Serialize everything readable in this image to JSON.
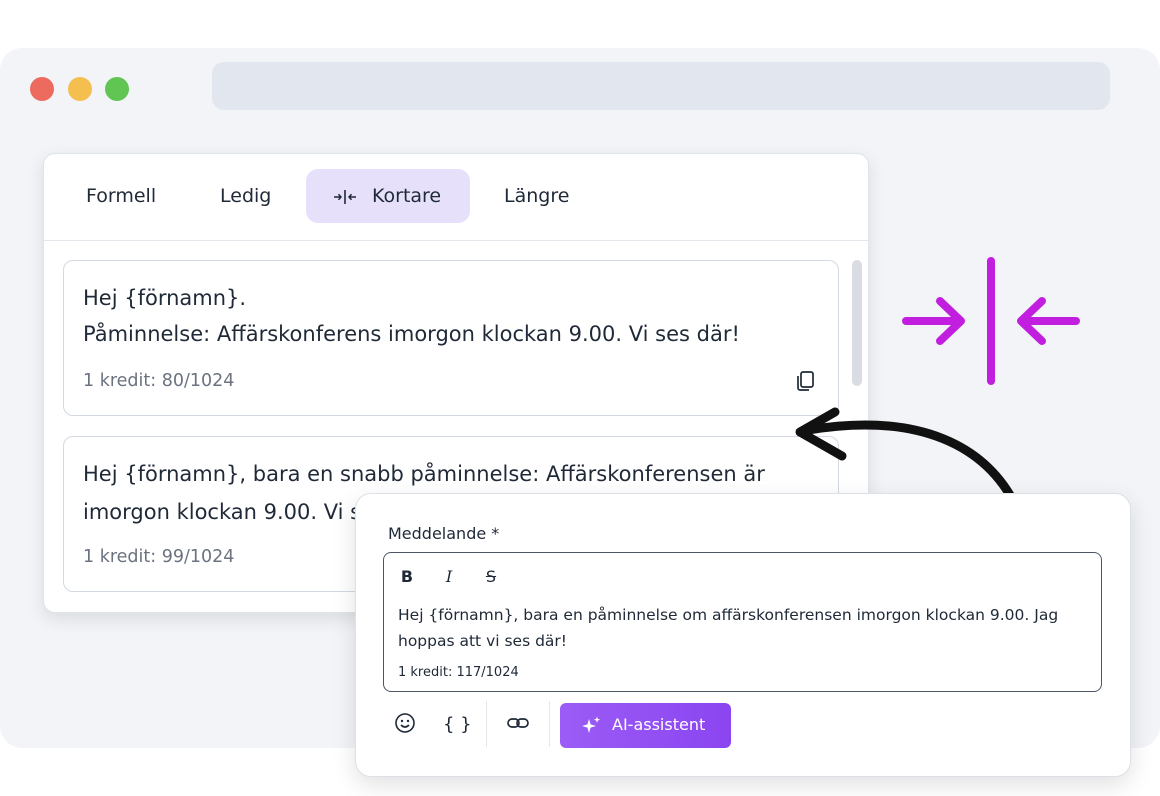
{
  "window": {
    "dots": [
      "#ec6a5e",
      "#f4bf4f",
      "#61c554"
    ]
  },
  "tabs": [
    {
      "label": "Formell",
      "active": false
    },
    {
      "label": "Ledig",
      "active": false
    },
    {
      "label": "Kortare",
      "active": true,
      "icon": "compress-icon"
    },
    {
      "label": "Längre",
      "active": false
    }
  ],
  "cards": [
    {
      "lines": [
        "Hej {förnamn}.",
        "Påminnelse: Affärskonferens imorgon klockan 9.00. Vi ses där!"
      ],
      "credit": "1 kredit: 80/1024"
    },
    {
      "lines": [
        "Hej {förnamn}, bara en snabb påminnelse: Affärskonferensen är",
        "imorgon klockan 9.00. Vi ses där!"
      ],
      "credit": "1 kredit: 99/1024"
    }
  ],
  "composer": {
    "label": "Meddelande *",
    "format_buttons": {
      "bold": "B",
      "italic": "I",
      "strike": "S"
    },
    "message_lines": [
      "Hej {förnamn}, bara en påminnelse om affärskonferensen imorgon klockan 9.00. Jag",
      "hoppas att vi ses där!"
    ],
    "credit": "1 kredit: 117/1024",
    "variables_label": "{ }",
    "ai_button_label": "AI-assistent"
  },
  "colors": {
    "accent": "#9b5cf6",
    "highlight": "#c21ee0",
    "tab_active_bg": "#e6e0fb"
  }
}
